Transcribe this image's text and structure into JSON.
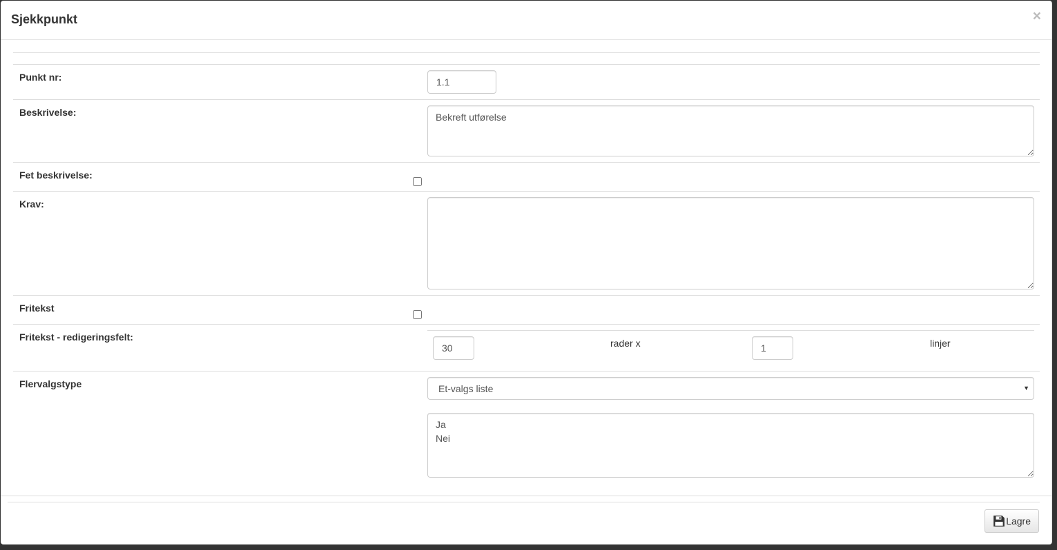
{
  "dialog": {
    "title": "Sjekkpunkt",
    "close_label": "×"
  },
  "form": {
    "punkt_nr": {
      "label": "Punkt nr:",
      "value": "1.1"
    },
    "beskrivelse": {
      "label": "Beskrivelse:",
      "value": "Bekreft utførelse"
    },
    "fet_beskrivelse": {
      "label": "Fet beskrivelse:",
      "checked": false
    },
    "krav": {
      "label": "Krav:",
      "value": ""
    },
    "fritekst": {
      "label": "Fritekst",
      "checked": false
    },
    "fritekst_felt": {
      "label": "Fritekst - redigeringsfelt:",
      "rows_value": "30",
      "rows_suffix": "rader x",
      "lines_value": "1",
      "lines_suffix": "linjer"
    },
    "flervalgstype": {
      "label": "Flervalgstype",
      "selected": "Et-valgs liste",
      "options_text": "Ja\nNei"
    }
  },
  "footer": {
    "save_label": "Lagre",
    "save_icon": "floppy-disk-icon"
  }
}
